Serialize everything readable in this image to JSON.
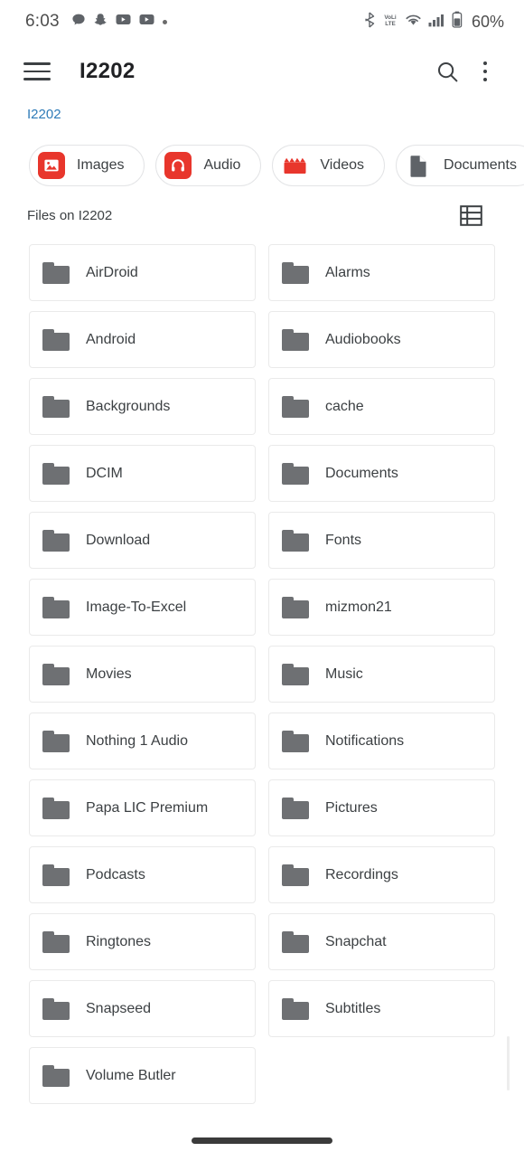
{
  "status_bar": {
    "time": "6:03",
    "left_icons": [
      "chat-bubble-icon",
      "snapchat-icon",
      "youtube-icon",
      "youtube-icon",
      "dot-icon"
    ],
    "right_icons": [
      "bluetooth-icon",
      "volte-icon",
      "wifi-icon",
      "signal-icon",
      "battery-icon"
    ],
    "battery_text": "60%"
  },
  "app_bar": {
    "title": "I2202",
    "menu_icon": "hamburger-icon",
    "search_icon": "search-icon",
    "overflow_icon": "more-vertical-icon"
  },
  "breadcrumb": {
    "items": [
      "I2202"
    ]
  },
  "chips": [
    {
      "label": "Images",
      "icon": "image-icon",
      "style": "red"
    },
    {
      "label": "Audio",
      "icon": "headphones-icon",
      "style": "red"
    },
    {
      "label": "Videos",
      "icon": "clapperboard-icon",
      "style": "red"
    },
    {
      "label": "Documents",
      "icon": "document-icon",
      "style": "grey"
    }
  ],
  "section": {
    "title": "Files on I2202",
    "view_toggle_icon": "list-view-icon"
  },
  "folders": [
    {
      "name": "AirDroid"
    },
    {
      "name": "Alarms"
    },
    {
      "name": "Android"
    },
    {
      "name": "Audiobooks"
    },
    {
      "name": "Backgrounds"
    },
    {
      "name": "cache"
    },
    {
      "name": "DCIM"
    },
    {
      "name": "Documents"
    },
    {
      "name": "Download"
    },
    {
      "name": "Fonts"
    },
    {
      "name": "Image-To-Excel"
    },
    {
      "name": "mizmon21"
    },
    {
      "name": "Movies"
    },
    {
      "name": "Music"
    },
    {
      "name": "Nothing 1 Audio"
    },
    {
      "name": "Notifications"
    },
    {
      "name": "Papa LIC Premium"
    },
    {
      "name": "Pictures"
    },
    {
      "name": "Podcasts"
    },
    {
      "name": "Recordings"
    },
    {
      "name": "Ringtones"
    },
    {
      "name": "Snapchat"
    },
    {
      "name": "Snapseed"
    },
    {
      "name": "Subtitles"
    },
    {
      "name": "Volume Butler"
    }
  ],
  "colors": {
    "accent_red": "#e8362c",
    "link_blue": "#2e7bb8",
    "folder_grey": "#6e7073",
    "text_primary": "#3c4043"
  }
}
